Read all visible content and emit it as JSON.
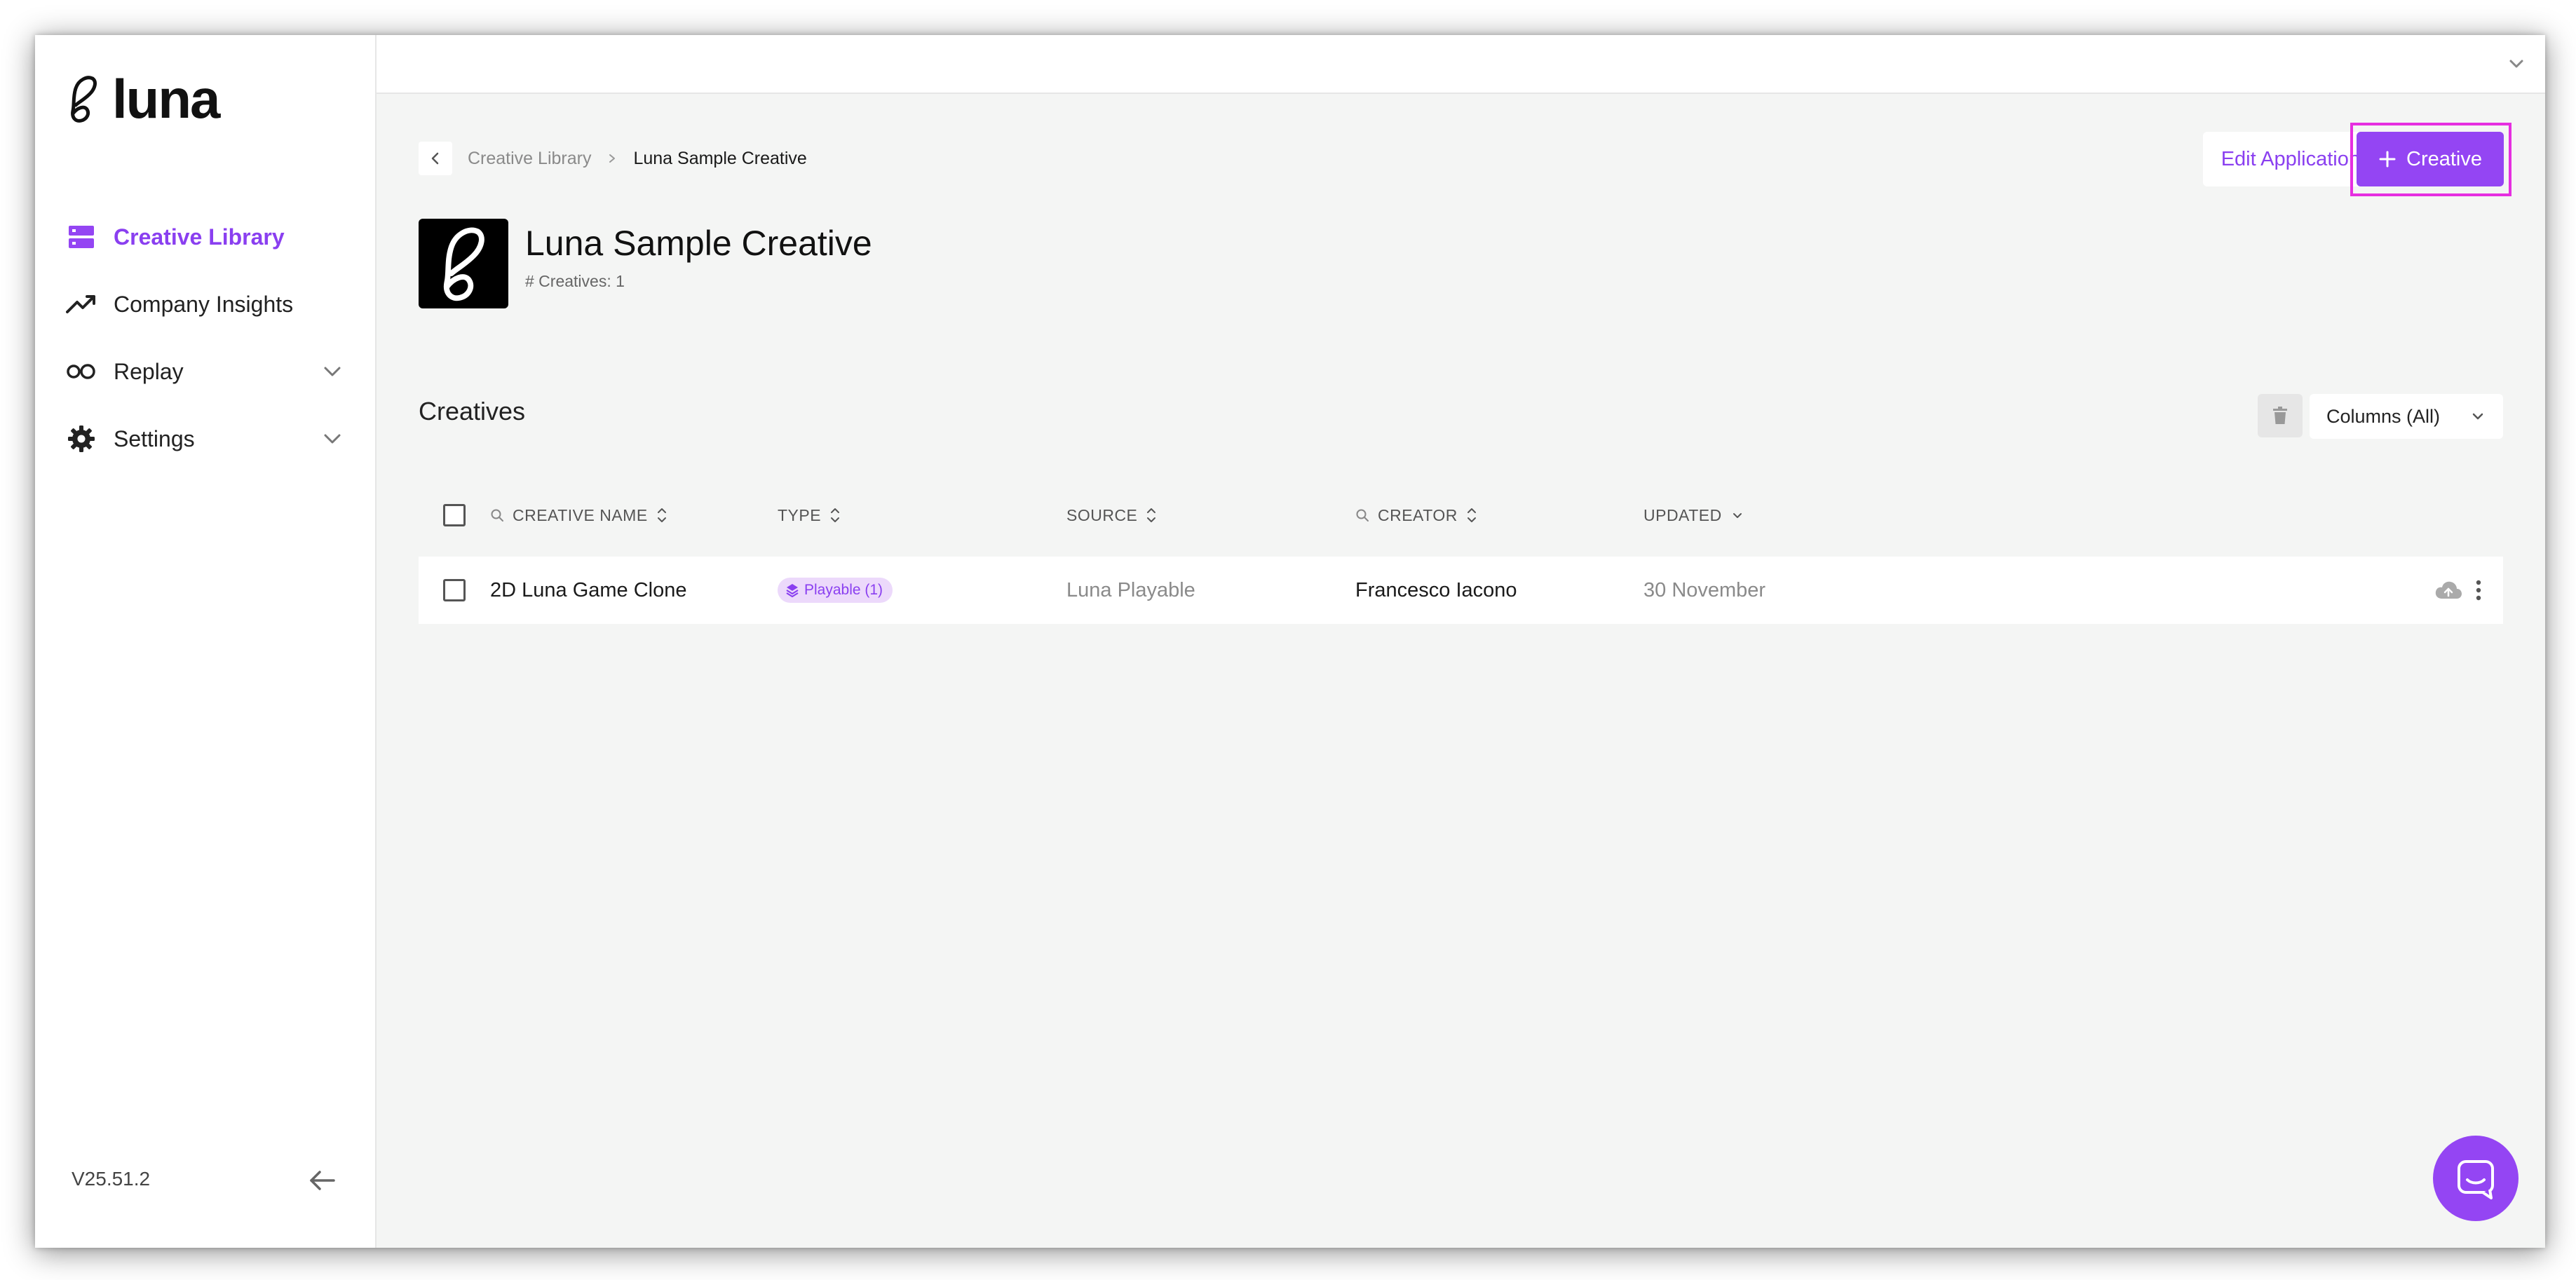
{
  "brand": {
    "name": "luna",
    "accent": "#9445f3"
  },
  "sidebar": {
    "items": [
      {
        "label": "Creative Library",
        "icon": "database-icon",
        "active": true
      },
      {
        "label": "Company Insights",
        "icon": "trending-up-icon",
        "active": false
      },
      {
        "label": "Replay",
        "icon": "infinity-icon",
        "expandable": true
      },
      {
        "label": "Settings",
        "icon": "gear-icon",
        "expandable": true
      }
    ],
    "version": "V25.51.2"
  },
  "breadcrumb": {
    "parent": "Creative Library",
    "current": "Luna Sample Creative"
  },
  "actions": {
    "edit_application": "Edit Application",
    "add_creative": "Creative"
  },
  "app": {
    "title": "Luna Sample Creative",
    "subtitle": "# Creatives: 1"
  },
  "section": {
    "title": "Creatives",
    "columns_select": "Columns (All)"
  },
  "table": {
    "headers": {
      "name": "CREATIVE NAME",
      "type": "TYPE",
      "source": "SOURCE",
      "creator": "CREATOR",
      "updated": "UPDATED"
    },
    "rows": [
      {
        "name": "2D Luna Game Clone",
        "type": "Playable (1)",
        "source": "Luna Playable",
        "creator": "Francesco Iacono",
        "updated": "30 November"
      }
    ]
  }
}
